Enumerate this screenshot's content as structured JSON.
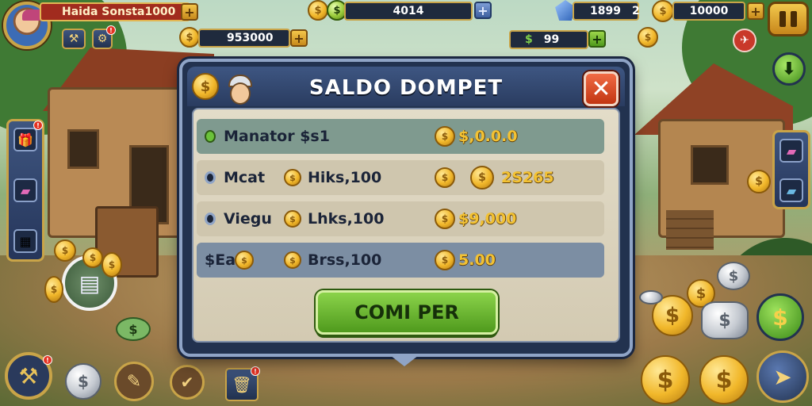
{
  "hud": {
    "player_name": "Haida Sonsta1000",
    "coins_left": "953000",
    "score": "4014",
    "gems": "1899",
    "gems_multiplier": "2",
    "gold": "10000",
    "cash_label": "$",
    "cash": "99"
  },
  "dialog": {
    "title": "SALDO DOMPET",
    "close_label": "✕",
    "buy_label": "COMI PER",
    "rows": [
      {
        "name": "Manator $s1",
        "mid": "",
        "amount": "$,0.0.0"
      },
      {
        "name": "Mcat",
        "mid": "Hiks,100",
        "amount": "2S265"
      },
      {
        "name": "Viegu",
        "mid": "Lhks,100",
        "amount": "$9,000"
      },
      {
        "name": "$Ea",
        "mid": "Brss,100",
        "amount": "5.00"
      }
    ]
  },
  "icons": {
    "currency": "$",
    "badge": "!"
  },
  "colors": {
    "accent_gold": "#c9a448",
    "panel_blue": "#22324f",
    "buy_green": "#6fbf32",
    "close_red": "#d84a22"
  }
}
